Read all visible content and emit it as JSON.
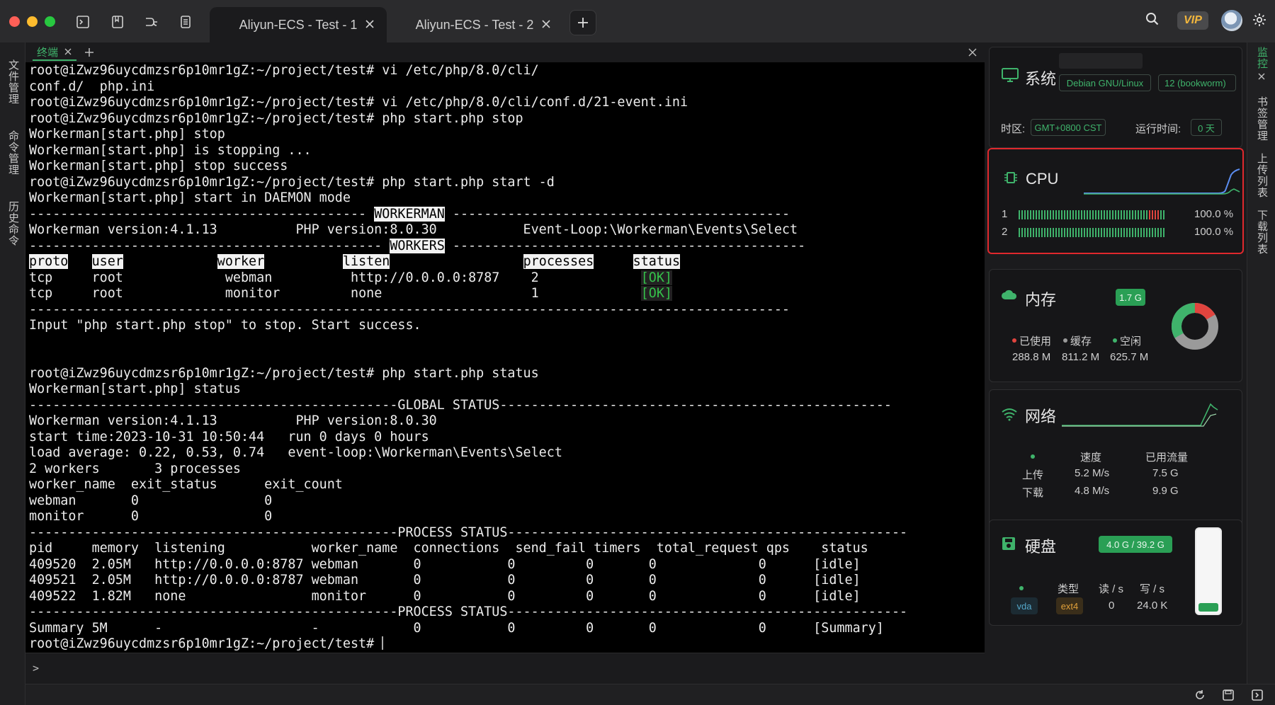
{
  "tabs": [
    {
      "label": "Aliyun-ECS - Test - 1",
      "active": true
    },
    {
      "label": "Aliyun-ECS - Test - 2",
      "active": false
    }
  ],
  "topbar": {
    "vip_label": "VIP"
  },
  "left_sidebar": {
    "items": [
      "文件管理",
      "命令管理",
      "历史命令"
    ]
  },
  "terminal": {
    "tab_label": "终端",
    "lines": [
      "root@iZwz96uycdmzsr6p10mr1gZ:~/project/test# vi /etc/php/8.0/cli/",
      "conf.d/  php.ini",
      "root@iZwz96uycdmzsr6p10mr1gZ:~/project/test# vi /etc/php/8.0/cli/conf.d/21-event.ini",
      "root@iZwz96uycdmzsr6p10mr1gZ:~/project/test# php start.php stop",
      "Workerman[start.php] stop",
      "Workerman[start.php] is stopping ...",
      "Workerman[start.php] stop success",
      "root@iZwz96uycdmzsr6p10mr1gZ:~/project/test# php start.php start -d",
      "Workerman[start.php] start in DAEMON mode"
    ],
    "workerman_banner": "WORKERMAN",
    "workers_banner": "WORKERS",
    "version_line": "Workerman version:4.1.13          PHP version:8.0.30           Event-Loop:\\Workerman\\Events\\Select",
    "workers_headers": [
      "proto",
      "user",
      "worker",
      "listen",
      "processes",
      "status"
    ],
    "workers_rows": [
      [
        "tcp",
        "root",
        "webman",
        "http://0.0.0.0:8787",
        "2",
        "[OK]"
      ],
      [
        "tcp",
        "root",
        "monitor",
        "none",
        "1",
        "[OK]"
      ]
    ],
    "stop_hint": "Input \"php start.php stop\" to stop. Start success.",
    "status_cmd": "root@iZwz96uycdmzsr6p10mr1gZ:~/project/test# php start.php status",
    "status_line": "Workerman[start.php] status",
    "global_status_banner": "GLOBAL STATUS",
    "global_lines": [
      "Workerman version:4.1.13          PHP version:8.0.30",
      "start time:2023-10-31 10:50:44   run 0 days 0 hours",
      "load average: 0.22, 0.53, 0.74   event-loop:\\Workerman\\Events\\Select",
      "2 workers       3 processes",
      "worker_name  exit_status      exit_count",
      "webman       0                0",
      "monitor      0                0"
    ],
    "process_status_banner": "PROCESS STATUS",
    "process_lines": [
      "pid     memory  listening           worker_name  connections  send_fail timers  total_request qps    status",
      "409520  2.05M   http://0.0.0.0:8787 webman       0           0         0       0             0      [idle]",
      "409521  2.05M   http://0.0.0.0:8787 webman       0           0         0       0             0      [idle]",
      "409522  1.82M   none                monitor      0           0         0       0             0      [idle]"
    ],
    "summary_line": "Summary 5M      -                   -            0           0         0       0             0      [Summary]",
    "final_prompt": "root@iZwz96uycdmzsr6p10mr1gZ:~/project/test# ",
    "input_prompt": ">"
  },
  "monitor": {
    "system": {
      "title": "系统",
      "os_label": "Debian GNU/Linux",
      "version_label": "12 (bookworm)",
      "timezone_label": "时区:",
      "timezone_value": "GMT+0800   CST",
      "uptime_label": "运行时间:",
      "uptime_value": "0 天"
    },
    "cpu": {
      "title": "CPU",
      "cores": [
        {
          "id": "1",
          "usage_text": "100.0 %",
          "usage": 1.0
        },
        {
          "id": "2",
          "usage_text": "100.0 %",
          "usage": 1.0
        }
      ]
    },
    "memory": {
      "title": "内存",
      "total": "1.7 G",
      "legend": [
        "已使用",
        "缓存",
        "空闲"
      ],
      "values": [
        "288.8 M",
        "811.2 M",
        "625.7 M"
      ]
    },
    "network": {
      "title": "网络",
      "headers": [
        "速度",
        "已用流量"
      ],
      "rows": [
        {
          "label": "上传",
          "speed": "5.2 M/s",
          "used": "7.5 G"
        },
        {
          "label": "下载",
          "speed": "4.8 M/s",
          "used": "9.9 G"
        }
      ]
    },
    "disk": {
      "title": "硬盘",
      "usage": "4.0 G / 39.2 G",
      "usage_fraction": 0.1,
      "headers": [
        "类型",
        "读 / s",
        "写 / s"
      ],
      "device": "vda",
      "type": "ext4",
      "read": "0",
      "write": "24.0 K"
    }
  },
  "right_rail": {
    "items": [
      "监控",
      "书签管理",
      "上传列表",
      "下载列表"
    ]
  },
  "colors": {
    "accent": "#3fb36b",
    "highlight_border": "#e0282d"
  }
}
